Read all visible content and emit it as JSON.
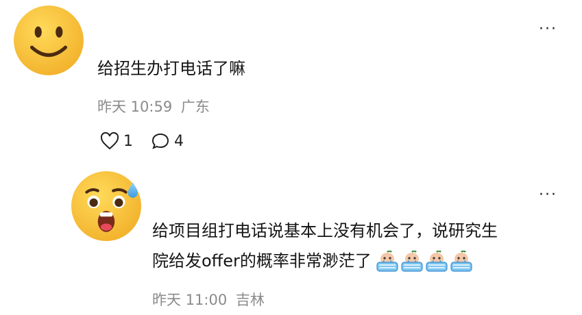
{
  "comments": [
    {
      "avatar_icon": "smiling-face-emoji",
      "text": "给招生办打电话了嘛",
      "time": "昨天 10:59",
      "location": "广东",
      "likes": "1",
      "replies": "4",
      "more_label": "···"
    },
    {
      "avatar_icon": "anxious-face-with-sweat-emoji",
      "text_line1": "给项目组打电话说基本上没有机会了，说研究生",
      "text_line2": "院给发offer的概率非常渺茫了",
      "sticker_icon": "crying-in-bathtub-sticker",
      "sticker_count": 4,
      "time": "昨天 11:00",
      "location": "吉林",
      "more_label": "···"
    }
  ],
  "colors": {
    "emoji_yellow": "#F7C436",
    "meta_gray": "#8a8a8a",
    "text_dark": "#141414"
  }
}
